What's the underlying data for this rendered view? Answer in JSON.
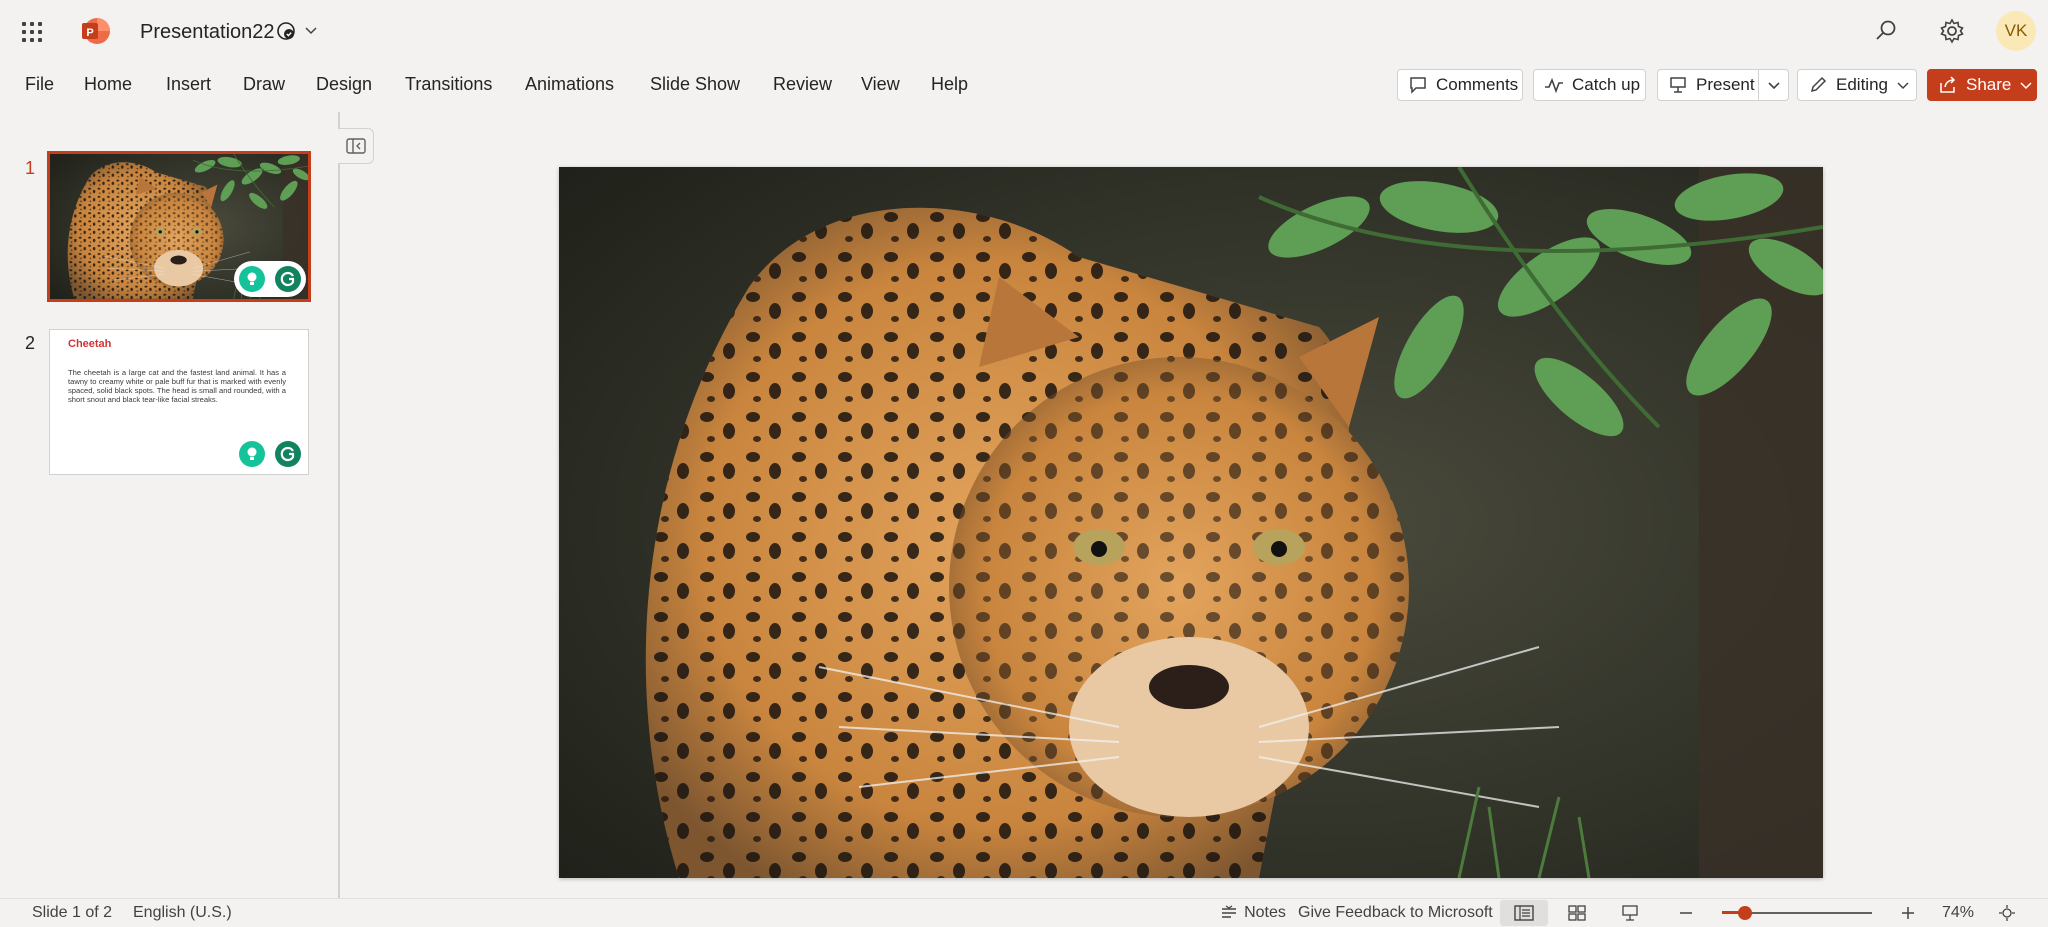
{
  "app": {
    "name": "PowerPoint",
    "document_title": "Presentation22",
    "user_initials": "VK",
    "accent_color": "#c43e1c"
  },
  "icons": {
    "app_launcher": "waffle-icon",
    "save_status": "saved-cloud-check-icon",
    "search": "search-icon",
    "settings": "gear-icon"
  },
  "ribbon": {
    "tabs": [
      "File",
      "Home",
      "Insert",
      "Draw",
      "Design",
      "Transitions",
      "Animations",
      "Slide Show",
      "Review",
      "View",
      "Help"
    ],
    "comments_label": "Comments",
    "catchup_label": "Catch up",
    "present_label": "Present",
    "editing_label": "Editing",
    "share_label": "Share"
  },
  "thumbnails": {
    "items": [
      {
        "number": "1",
        "selected": true,
        "content": "leopard photo"
      },
      {
        "number": "2",
        "selected": false,
        "title": "Cheetah",
        "body": "The cheetah is a large cat and the fastest land animal. It has a tawny to creamy white or pale buff fur that is marked with evenly spaced, solid black spots. The head is small and rounded, with a short snout and black tear-like facial streaks."
      }
    ]
  },
  "status": {
    "slide_indicator": "Slide 1 of 2",
    "language": "English (U.S.)",
    "notes_label": "Notes",
    "feedback_label": "Give Feedback to Microsoft",
    "zoom_level": "74%",
    "zoom_fraction": 0.15
  }
}
